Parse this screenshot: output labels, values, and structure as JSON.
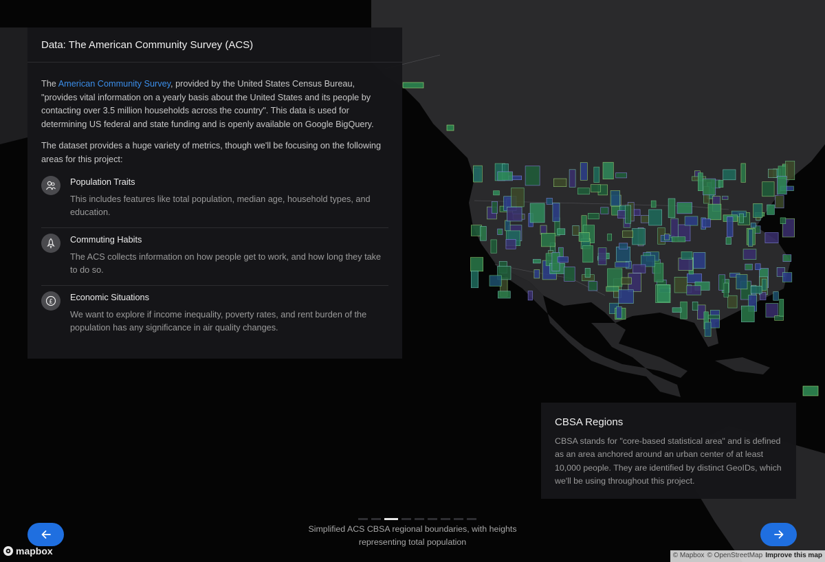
{
  "info_panel": {
    "title": "Data: The American Community Survey (ACS)",
    "intro_prefix": "The ",
    "intro_link": "American Community Survey",
    "intro_suffix": ", provided by the United States Census Bureau, \"provides vital information on a yearly basis about the United States and its people by contacting over 3.5 million households across the country\". This data is used for determining US federal and state funding and is openly available on Google BigQuery.",
    "focus_text": "The dataset provides a huge variety of metrics, though we'll be focusing on the following areas for this project:",
    "features": [
      {
        "icon": "people-icon",
        "title": "Population Traits",
        "desc": "This includes features like total population, median age, household types, and education."
      },
      {
        "icon": "rocket-icon",
        "title": "Commuting Habits",
        "desc": "The ACS collects information on how people get to work, and how long they take to do so."
      },
      {
        "icon": "pound-icon",
        "title": "Economic Situations",
        "desc": "We want to explore if income inequality, poverty rates, and rent burden of the population has any significance in air quality changes."
      }
    ]
  },
  "cbsa_panel": {
    "title": "CBSA Regions",
    "desc": "CBSA stands for \"core-based statistical area\" and is defined as an area anchored around an urban center of at least 10,000 people. They are identified by distinct GeoIDs, which we'll be using throughout this project."
  },
  "progress": {
    "total": 9,
    "current": 3
  },
  "caption": "Simplified ACS CBSA regional boundaries, with heights representing total population",
  "nav": {
    "prev_icon": "arrow-left-icon",
    "next_icon": "arrow-right-icon"
  },
  "mapbox": {
    "logo_text": "mapbox"
  },
  "attribution": {
    "mapbox": "© Mapbox",
    "osm": "© OpenStreetMap",
    "improve": "Improve this map"
  },
  "colors": {
    "accent": "#1f6fe0",
    "link": "#3b8eea",
    "panel": "#161619",
    "land": "#2b2b2d",
    "water": "#050505"
  }
}
